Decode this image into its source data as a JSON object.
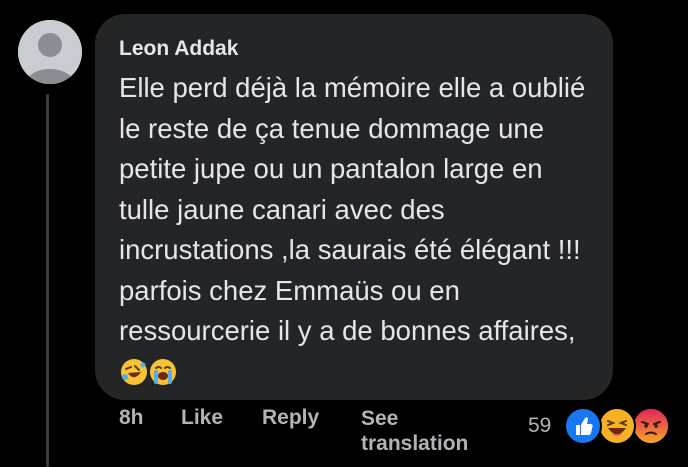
{
  "comment": {
    "author": "Leon Addak",
    "text": "Elle perd déjà la mémoire elle a oublié le reste de ça tenue dommage une petite jupe ou un pantalon large en tulle jaune canari avec des incrustations ,la saurais été élégant !!! parfois chez Emmaüs ou en ressourcerie il y a de bonnes affaires,",
    "inline_emojis": [
      "rolling-on-floor-laughing",
      "loudly-crying-face"
    ]
  },
  "actions": {
    "time": "8h",
    "like_label": "Like",
    "reply_label": "Reply",
    "translate_label": "See translation"
  },
  "reactions": {
    "count": "59",
    "types": [
      "like",
      "haha",
      "angry"
    ]
  },
  "colors": {
    "background": "#000000",
    "bubble": "#242526",
    "text": "#e4e6eb",
    "secondary_text": "#b0b3b8",
    "like_blue": "#1877f2",
    "haha_yellow": "#f7b125",
    "angry_red": "#e9710f"
  }
}
